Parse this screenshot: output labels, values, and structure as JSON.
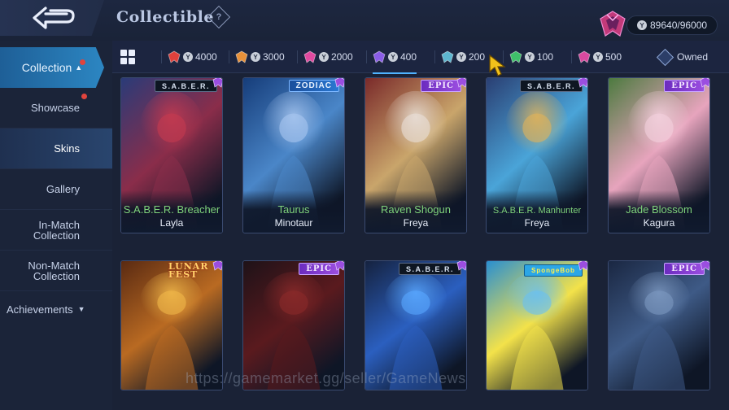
{
  "header": {
    "title": "Collectible",
    "help_label": "?",
    "points": "89640/96000",
    "coin_symbol": "Y"
  },
  "sidebar": {
    "main": {
      "label": "Collection",
      "chevron": "▲"
    },
    "items": [
      {
        "label": "Showcase",
        "dot": true
      },
      {
        "label": "Skins",
        "selected": true
      },
      {
        "label": "Gallery"
      },
      {
        "label": "In-Match Collection"
      },
      {
        "label": "Non-Match Collection"
      }
    ],
    "achievements": {
      "label": "Achievements",
      "chevron": "▼"
    }
  },
  "filters": [
    {
      "value": "4000",
      "gem_color": "#e0413c"
    },
    {
      "value": "3000",
      "gem_color": "#e8913a"
    },
    {
      "value": "2000",
      "gem_color": "#e04aa0"
    },
    {
      "value": "400",
      "gem_color": "#8a5de6",
      "active": true
    },
    {
      "value": "200",
      "gem_color": "#5db6cf"
    },
    {
      "value": "100",
      "gem_color": "#3fbf6a"
    },
    {
      "value": "500",
      "gem_color": "#d94aa0"
    }
  ],
  "owned_label": "Owned",
  "cards_row1": [
    {
      "tag": "S.A.B.E.R.",
      "tag_type": "saber",
      "skin": "S.A.B.E.R. Breacher",
      "hero": "Layla",
      "skin_small": false,
      "art": [
        "#2a3b78",
        "#8a2d4a",
        "#c43a50"
      ]
    },
    {
      "tag": "ZODIAC",
      "tag_type": "zodiac",
      "skin": "Taurus",
      "hero": "Minotaur",
      "skin_small": false,
      "art": [
        "#163d7a",
        "#4a86c8",
        "#a9c7f0"
      ]
    },
    {
      "tag": "EPIC",
      "tag_type": "epic",
      "skin": "Raven Shogun",
      "hero": "Freya",
      "skin_small": false,
      "art": [
        "#7a2a2a",
        "#c9a56b",
        "#e9e0d8"
      ]
    },
    {
      "tag": "S.A.B.E.R.",
      "tag_type": "saber",
      "skin": "S.A.B.E.R. Manhunter",
      "hero": "Freya",
      "skin_small": true,
      "art": [
        "#2a3f73",
        "#4aa4d8",
        "#e0b35a"
      ]
    },
    {
      "tag": "EPIC",
      "tag_type": "epic",
      "skin": "Jade Blossom",
      "hero": "Kagura",
      "skin_small": false,
      "art": [
        "#4c7a3f",
        "#e7a4bd",
        "#f4d1de"
      ]
    }
  ],
  "cards_row2": [
    {
      "tag": "LUNAR FEST",
      "tag_type": "lunar",
      "art": [
        "#5a2a12",
        "#b96a22",
        "#f0b84a"
      ]
    },
    {
      "tag": "EPIC",
      "tag_type": "epic",
      "art": [
        "#1e1218",
        "#5a1a1e",
        "#8a2a2a"
      ]
    },
    {
      "tag": "S.A.B.E.R.",
      "tag_type": "saber",
      "art": [
        "#15223f",
        "#2b5fbf",
        "#59a7ff"
      ]
    },
    {
      "tag": "SpongeBob",
      "tag_type": "sponge",
      "art": [
        "#2a8fd0",
        "#f3e24a",
        "#6ac0f0"
      ]
    },
    {
      "tag": "EPIC",
      "tag_type": "epic",
      "art": [
        "#1a2742",
        "#3e5a86",
        "#7c98c0"
      ]
    }
  ],
  "watermark": "https://gamemarket.gg/seller/GameNews"
}
